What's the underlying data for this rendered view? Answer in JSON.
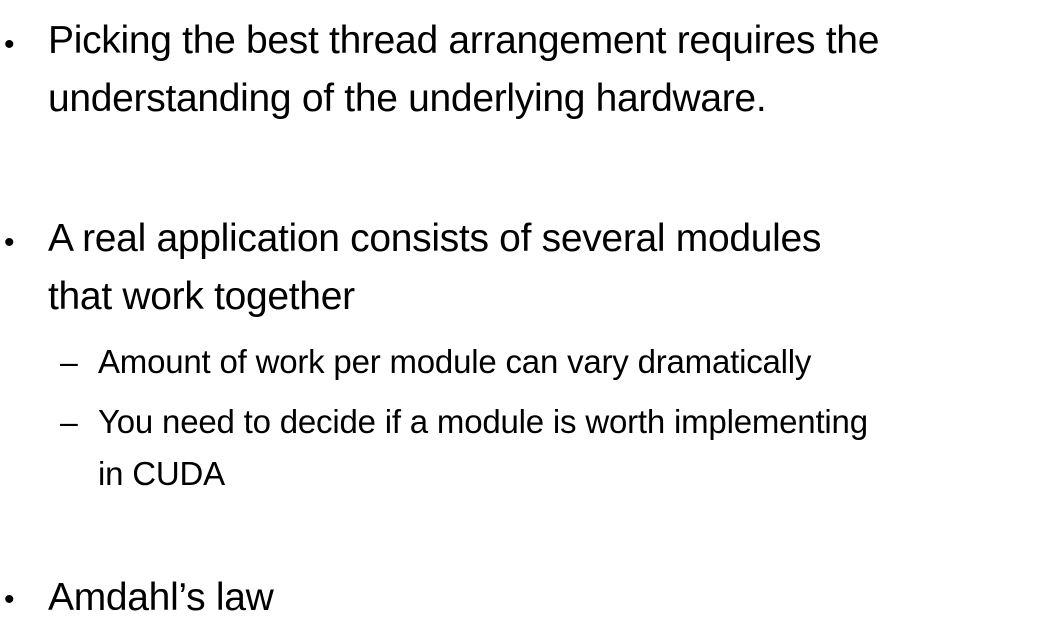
{
  "bullets": [
    {
      "marker": "•",
      "lines": [
        "Picking the best thread arrangement requires the",
        "understanding of the underlying hardware."
      ]
    },
    {
      "marker": "•",
      "lines": [
        "A real application consists of several modules",
        "that work together"
      ],
      "sub_bullets": [
        {
          "marker": "–",
          "lines": [
            "Amount of work per module can vary dramatically"
          ]
        },
        {
          "marker": "–",
          "lines": [
            "You need to decide if a module is worth implementing",
            "in CUDA"
          ]
        }
      ]
    },
    {
      "marker": "•",
      "lines": [
        "Amdahl’s law"
      ]
    }
  ]
}
